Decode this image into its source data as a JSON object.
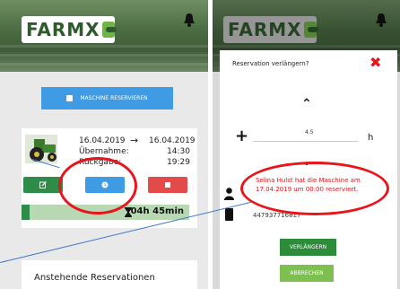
{
  "left_screen": {
    "brand": "FARMX",
    "reserve_button": "MASCHINE RESERVIEREN",
    "reservation": {
      "date_start": "16.04.2019",
      "date_end": "16.04.2019",
      "arrow": "→",
      "pickup_label": "Übernahme:",
      "pickup_time": "14:30",
      "return_label": "Rückgabe:",
      "return_time": "19:29",
      "remaining": "04h 45min",
      "remaining_fraction": 0.05
    },
    "upcoming_title": "Anstehende Reservationen",
    "colors": {
      "edit": "#2d8c47",
      "time": "#3f9be3",
      "stop": "#e34b4b"
    }
  },
  "right_screen": {
    "brand": "FARMX",
    "dialog_title": "Reservation verlängern?",
    "close_symbol": "✖",
    "chevron_up": "⌃",
    "chevron_down": "⌄",
    "plus": "+",
    "value": "4.5",
    "unit": "h",
    "message": "Selina Hulst hat die Maschine am 17.04.2019 um 00:00 reserviert.",
    "phone": "447937716817",
    "extend_button": "VERLÄNGERN",
    "cancel_button": "ABBRECHEN"
  }
}
